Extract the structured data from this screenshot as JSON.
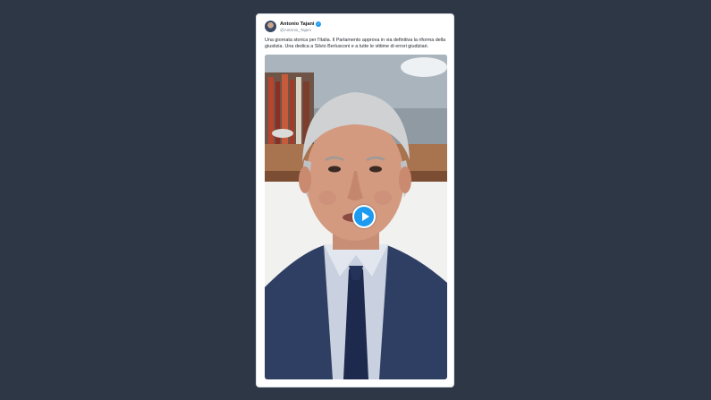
{
  "tweet": {
    "author_name": "Antonio Tajani",
    "author_handle": "@Antonio_Tajani",
    "verified": true,
    "text": "Una giornata storica per l'Italia. Il Parlamento approva in via definitiva la riforma della giustizia. Una dedica a Silvio Berlusconi e a tutte le vittime di errori giudiziari.",
    "media": {
      "type": "video",
      "play_icon": "play-icon"
    }
  },
  "colors": {
    "page_background": "#2e3746",
    "card_background": "#ffffff",
    "accent": "#1d9bf0"
  }
}
